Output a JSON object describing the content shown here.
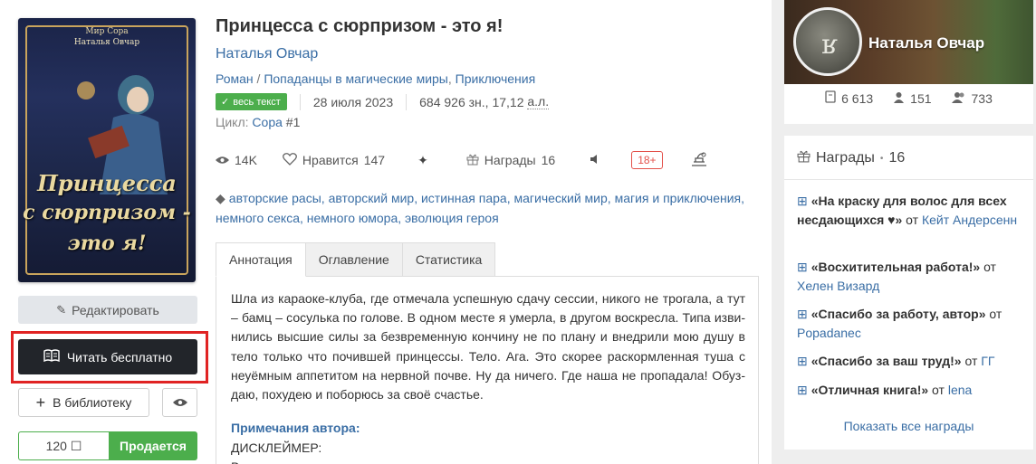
{
  "book": {
    "cover": {
      "series": "Мир Сора",
      "author": "Наталья Овчар",
      "title_lines": [
        "Принцесса",
        "с сюрпризом -",
        "это я!"
      ]
    },
    "title": "Принцесса с сюрпризом - это я!",
    "author": "Наталья Овчар",
    "genres": [
      "Роман",
      "Попаданцы в магические миры",
      "Приключения"
    ],
    "status_badge": "весь текст",
    "date": "28 июля 2023",
    "size_prefix": "684 926 зн., 17,12 ",
    "size_unit": "а.л.",
    "cycle_label": "Цикл:",
    "cycle_name": "Сора",
    "cycle_num": "#1"
  },
  "stats": {
    "views": "14K",
    "likes_label": "Нравится",
    "likes": "147",
    "awards_label": "Награды",
    "awards": "16",
    "age": "18+"
  },
  "tags": [
    "авторские расы",
    "авторский мир",
    "истинная пара",
    "магический мир",
    "магия и приключения",
    "немного секса",
    "немного юмора",
    "эволюция героя"
  ],
  "actions": {
    "edit": "Редактировать",
    "read": "Читать бесплатно",
    "library": "В библиотеку",
    "price": "120 ☐",
    "sale": "Продается"
  },
  "tabs": [
    "Аннотация",
    "Оглавление",
    "Статистика"
  ],
  "annotation": "Шла из караоке-клуба, где отмечала успешную сдачу сессии, никого не трогала, а тут – бамц – сосулька по голове. В одном месте я умерла, в другом воскресла. Типа изви-нились высшие силы за безвременную кончину не по плану и внедрили мою душу в тело только что почившей принцессы. Тело. Ага. Это скорее раскормленная туша с неуёмным аппетитом на нервной почве. Ну да ничего. Где наша не пропадала! Обуз-даю, похудею и поборюсь за своё счастье.",
  "notes": {
    "heading": "Примечания автора:",
    "line1": "ДИСКЛЕЙМЕР:",
    "line2": "В"
  },
  "author_card": {
    "name": "Наталья Овчар",
    "books": "6 613",
    "friends": "151",
    "followers": "733"
  },
  "awards_panel": {
    "title": "Награды",
    "count": "16",
    "items": [
      {
        "name": "«На краску для волос для всех несдающихся ♥»",
        "from": "от",
        "user": "Кейт Андерсенн"
      },
      {
        "name": "«Восхитительная работа!»",
        "from": "от",
        "user": "Хелен Визард"
      },
      {
        "name": "«Спасибо за работу, автор»",
        "from": "от",
        "user": "Popadanec"
      },
      {
        "name": "«Спасибо за ваш труд!»",
        "from": "от",
        "user": "ГГ"
      },
      {
        "name": "«Отличная книга!»",
        "from": "от",
        "user": "lena"
      }
    ],
    "show_all": "Показать все награды"
  },
  "colors": {
    "accent": "#3a6ea5",
    "green": "#4cae4c",
    "dark_button": "#22252a",
    "highlight": "#e02323"
  }
}
